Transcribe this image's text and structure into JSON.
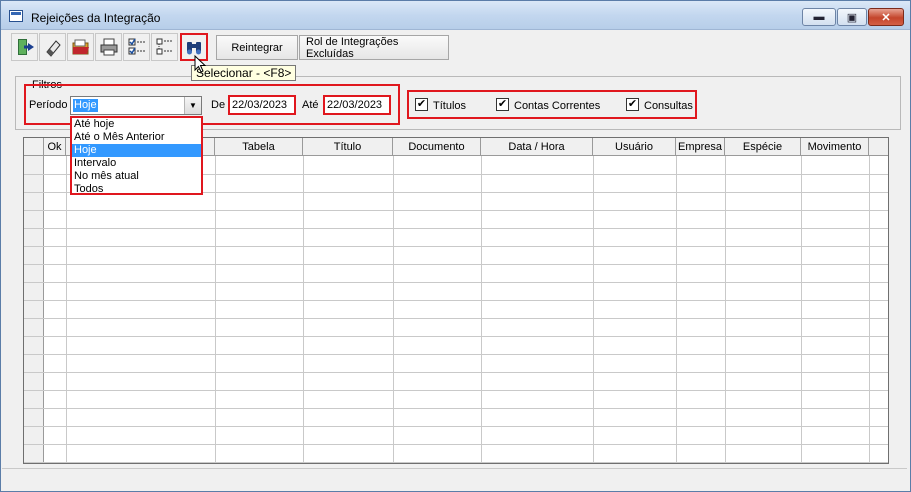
{
  "window": {
    "title": "Rejeições da Integração",
    "min_glyph": "▬",
    "max_glyph": "▣",
    "close_glyph": "✕"
  },
  "toolbar": {
    "icons": [
      "exit-door-icon",
      "eraser-icon",
      "folder-open-icon",
      "printer-icon",
      "checklist-icon",
      "tree-list-icon",
      "binoculars-icon"
    ],
    "reintegrar_label": "Reintegrar",
    "rol_label": "Rol de Integrações Excluídas"
  },
  "tooltip": "Selecionar - <F8>",
  "filters": {
    "legend": "Filtros",
    "periodo_label": "Período",
    "periodo_value": "Hoje",
    "de_label": "De",
    "de_value": "22/03/2023",
    "ate_label": "Até",
    "ate_value": "22/03/2023",
    "checkboxes": [
      {
        "label": "Títulos",
        "checked": true
      },
      {
        "label": "Contas Correntes",
        "checked": true
      },
      {
        "label": "Consultas",
        "checked": true
      }
    ],
    "check_glyph": "✔"
  },
  "dropdown": {
    "options": [
      "Até hoje",
      "Até o Mês Anterior",
      "Hoje",
      "Intervalo",
      "No mês atual",
      "Todos"
    ],
    "selected": "Hoje"
  },
  "grid": {
    "columns": [
      "",
      "Ok",
      "",
      "Tabela",
      "Título",
      "Documento",
      "Data / Hora",
      "Usuário",
      "Empresa",
      "Espécie",
      "Movimento",
      ""
    ]
  },
  "colors": {
    "highlight_red": "#e0171e",
    "selection_blue": "#3399ff"
  }
}
